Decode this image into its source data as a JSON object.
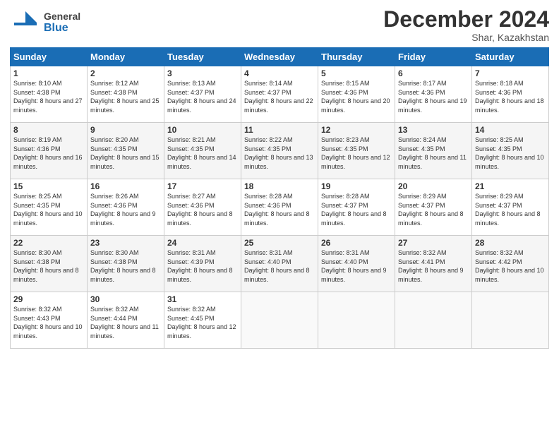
{
  "logo": {
    "general": "General",
    "blue": "Blue"
  },
  "header": {
    "month": "December 2024",
    "location": "Shar, Kazakhstan"
  },
  "days_of_week": [
    "Sunday",
    "Monday",
    "Tuesday",
    "Wednesday",
    "Thursday",
    "Friday",
    "Saturday"
  ],
  "weeks": [
    [
      {
        "day": "1",
        "sunrise": "8:10 AM",
        "sunset": "4:38 PM",
        "daylight": "8 hours and 27 minutes."
      },
      {
        "day": "2",
        "sunrise": "8:12 AM",
        "sunset": "4:38 PM",
        "daylight": "8 hours and 25 minutes."
      },
      {
        "day": "3",
        "sunrise": "8:13 AM",
        "sunset": "4:37 PM",
        "daylight": "8 hours and 24 minutes."
      },
      {
        "day": "4",
        "sunrise": "8:14 AM",
        "sunset": "4:37 PM",
        "daylight": "8 hours and 22 minutes."
      },
      {
        "day": "5",
        "sunrise": "8:15 AM",
        "sunset": "4:36 PM",
        "daylight": "8 hours and 20 minutes."
      },
      {
        "day": "6",
        "sunrise": "8:17 AM",
        "sunset": "4:36 PM",
        "daylight": "8 hours and 19 minutes."
      },
      {
        "day": "7",
        "sunrise": "8:18 AM",
        "sunset": "4:36 PM",
        "daylight": "8 hours and 18 minutes."
      }
    ],
    [
      {
        "day": "8",
        "sunrise": "8:19 AM",
        "sunset": "4:36 PM",
        "daylight": "8 hours and 16 minutes."
      },
      {
        "day": "9",
        "sunrise": "8:20 AM",
        "sunset": "4:35 PM",
        "daylight": "8 hours and 15 minutes."
      },
      {
        "day": "10",
        "sunrise": "8:21 AM",
        "sunset": "4:35 PM",
        "daylight": "8 hours and 14 minutes."
      },
      {
        "day": "11",
        "sunrise": "8:22 AM",
        "sunset": "4:35 PM",
        "daylight": "8 hours and 13 minutes."
      },
      {
        "day": "12",
        "sunrise": "8:23 AM",
        "sunset": "4:35 PM",
        "daylight": "8 hours and 12 minutes."
      },
      {
        "day": "13",
        "sunrise": "8:24 AM",
        "sunset": "4:35 PM",
        "daylight": "8 hours and 11 minutes."
      },
      {
        "day": "14",
        "sunrise": "8:25 AM",
        "sunset": "4:35 PM",
        "daylight": "8 hours and 10 minutes."
      }
    ],
    [
      {
        "day": "15",
        "sunrise": "8:25 AM",
        "sunset": "4:35 PM",
        "daylight": "8 hours and 10 minutes."
      },
      {
        "day": "16",
        "sunrise": "8:26 AM",
        "sunset": "4:36 PM",
        "daylight": "8 hours and 9 minutes."
      },
      {
        "day": "17",
        "sunrise": "8:27 AM",
        "sunset": "4:36 PM",
        "daylight": "8 hours and 8 minutes."
      },
      {
        "day": "18",
        "sunrise": "8:28 AM",
        "sunset": "4:36 PM",
        "daylight": "8 hours and 8 minutes."
      },
      {
        "day": "19",
        "sunrise": "8:28 AM",
        "sunset": "4:37 PM",
        "daylight": "8 hours and 8 minutes."
      },
      {
        "day": "20",
        "sunrise": "8:29 AM",
        "sunset": "4:37 PM",
        "daylight": "8 hours and 8 minutes."
      },
      {
        "day": "21",
        "sunrise": "8:29 AM",
        "sunset": "4:37 PM",
        "daylight": "8 hours and 8 minutes."
      }
    ],
    [
      {
        "day": "22",
        "sunrise": "8:30 AM",
        "sunset": "4:38 PM",
        "daylight": "8 hours and 8 minutes."
      },
      {
        "day": "23",
        "sunrise": "8:30 AM",
        "sunset": "4:38 PM",
        "daylight": "8 hours and 8 minutes."
      },
      {
        "day": "24",
        "sunrise": "8:31 AM",
        "sunset": "4:39 PM",
        "daylight": "8 hours and 8 minutes."
      },
      {
        "day": "25",
        "sunrise": "8:31 AM",
        "sunset": "4:40 PM",
        "daylight": "8 hours and 8 minutes."
      },
      {
        "day": "26",
        "sunrise": "8:31 AM",
        "sunset": "4:40 PM",
        "daylight": "8 hours and 9 minutes."
      },
      {
        "day": "27",
        "sunrise": "8:32 AM",
        "sunset": "4:41 PM",
        "daylight": "8 hours and 9 minutes."
      },
      {
        "day": "28",
        "sunrise": "8:32 AM",
        "sunset": "4:42 PM",
        "daylight": "8 hours and 10 minutes."
      }
    ],
    [
      {
        "day": "29",
        "sunrise": "8:32 AM",
        "sunset": "4:43 PM",
        "daylight": "8 hours and 10 minutes."
      },
      {
        "day": "30",
        "sunrise": "8:32 AM",
        "sunset": "4:44 PM",
        "daylight": "8 hours and 11 minutes."
      },
      {
        "day": "31",
        "sunrise": "8:32 AM",
        "sunset": "4:45 PM",
        "daylight": "8 hours and 12 minutes."
      },
      null,
      null,
      null,
      null
    ]
  ]
}
